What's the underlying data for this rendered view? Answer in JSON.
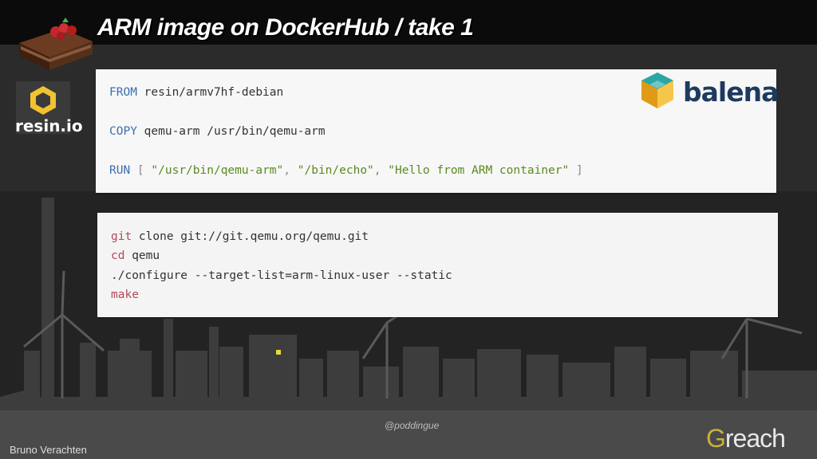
{
  "slide": {
    "title": "ARM image on DockerHub / take 1",
    "resin_label": "resin.io",
    "balena_label": "balena",
    "handle": "@poddingue",
    "author": "Bruno Verachten",
    "brand_first_letter": "G",
    "brand_rest": "reach"
  },
  "code1": {
    "l1_kw": "FROM",
    "l1_rest": " resin/armv7hf-debian",
    "l2_kw": "COPY",
    "l2_rest": " qemu-arm /usr/bin/qemu-arm",
    "l3_kw": "RUN",
    "l3_open": " [ ",
    "l3_s1": "\"/usr/bin/qemu-arm\"",
    "l3_c1": ", ",
    "l3_s2": "\"/bin/echo\"",
    "l3_c2": ", ",
    "l3_s3": "\"Hello from ARM container\"",
    "l3_close": " ]"
  },
  "code2": {
    "l1_kw": "git",
    "l1_rest": " clone git://git.qemu.org/qemu.git",
    "l2_kw": "cd",
    "l2_rest": " qemu",
    "l3": "./configure --target-list=arm-linux-user --static",
    "l4_kw": "make"
  },
  "colors": {
    "background": "#2b2b2b",
    "topbar": "#0b0b0b",
    "code_keyword_blue": "#3a6fb0",
    "code_keyword_red": "#b24a5b",
    "code_string_green": "#5b8a1f",
    "brand_gold": "#c9b13b"
  }
}
